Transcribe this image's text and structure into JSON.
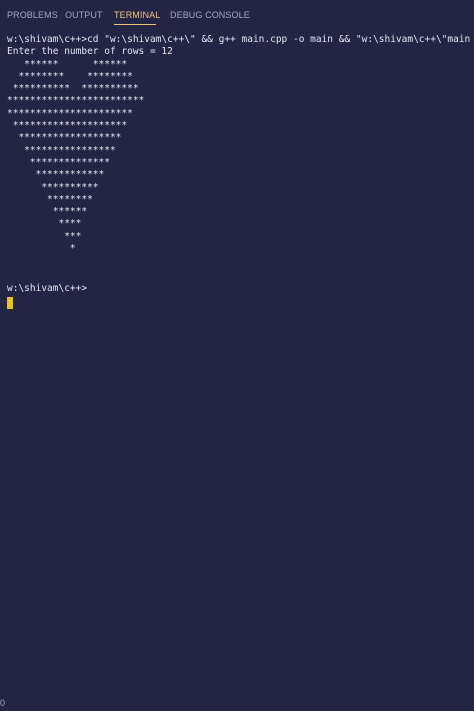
{
  "tabs": [
    {
      "label": "PROBLEMS",
      "active": false
    },
    {
      "label": "OUTPUT",
      "active": false
    },
    {
      "label": "TERMINAL",
      "active": true
    },
    {
      "label": "DEBUG CONSOLE",
      "active": false
    }
  ],
  "terminal": {
    "command": "w:\\shivam\\c++>cd \"w:\\shivam\\c++\\\" && g++ main.cpp -o main && \"w:\\shivam\\c++\\\"main",
    "input_prompt": "Enter the number of rows = 12",
    "pattern_lines": [
      "   ******      ******",
      "  ********    ********",
      " **********  **********",
      "************************",
      "**********************",
      " ********************",
      "  ******************",
      "   ****************",
      "    **************",
      "     ************",
      "      **********",
      "       ********",
      "        ******",
      "         ****",
      "          ***",
      "           *"
    ],
    "final_prompt": "w:\\shivam\\c++>"
  },
  "footer": {
    "number": "0"
  },
  "colors": {
    "background": "#222544",
    "active_tab": "#f0c27a",
    "inactive_tab": "#a4a8c9",
    "text": "#e6e6f2",
    "cursor": "#e8c229"
  }
}
